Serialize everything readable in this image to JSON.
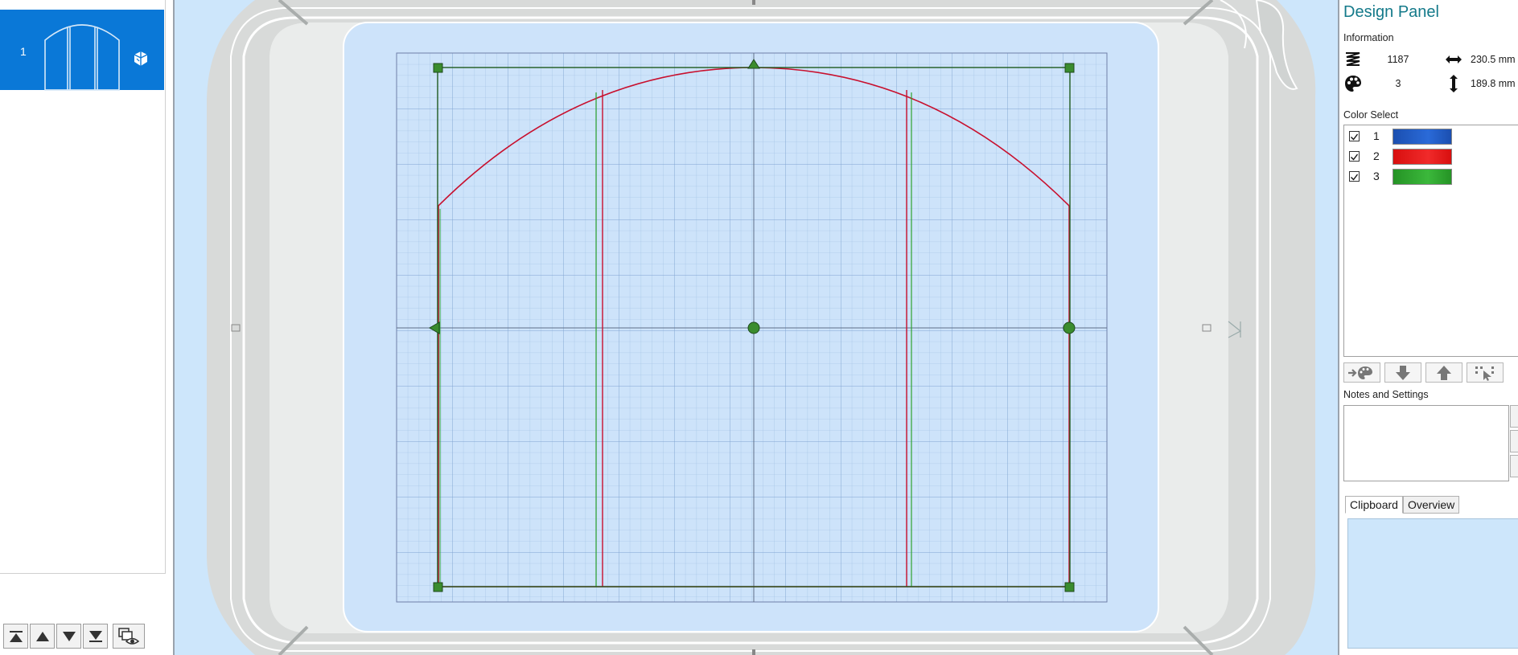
{
  "layers": {
    "items": [
      {
        "number": "1",
        "selected": true
      }
    ],
    "buttons": [
      "move-to-top",
      "move-up",
      "move-down",
      "move-to-bottom",
      "view-options"
    ]
  },
  "design_panel": {
    "title": "Design Panel",
    "information": {
      "heading": "Information",
      "stitch_count": "1187",
      "width": "230.5 mm",
      "color_count": "3",
      "height": "189.8 mm"
    },
    "color_select": {
      "heading": "Color Select",
      "colors": [
        {
          "number": "1",
          "checked": true,
          "hex": "#1f5fc4"
        },
        {
          "number": "2",
          "checked": true,
          "hex": "#e11a1a"
        },
        {
          "number": "3",
          "checked": true,
          "hex": "#2ea32e"
        }
      ]
    },
    "notes": {
      "heading": "Notes and Settings",
      "value": ""
    },
    "tabs": [
      {
        "label": "Clipboard",
        "active": true
      },
      {
        "label": "Overview",
        "active": false
      }
    ]
  },
  "colors": {
    "selection_blue": "#0a78d7",
    "workspace_bg": "#cde6fb",
    "hoop_gray": "#d7d9d8",
    "grid_line": "#8fb0d8",
    "selection_frame": "#1e5a1e",
    "handle_green": "#3a8c2e"
  }
}
